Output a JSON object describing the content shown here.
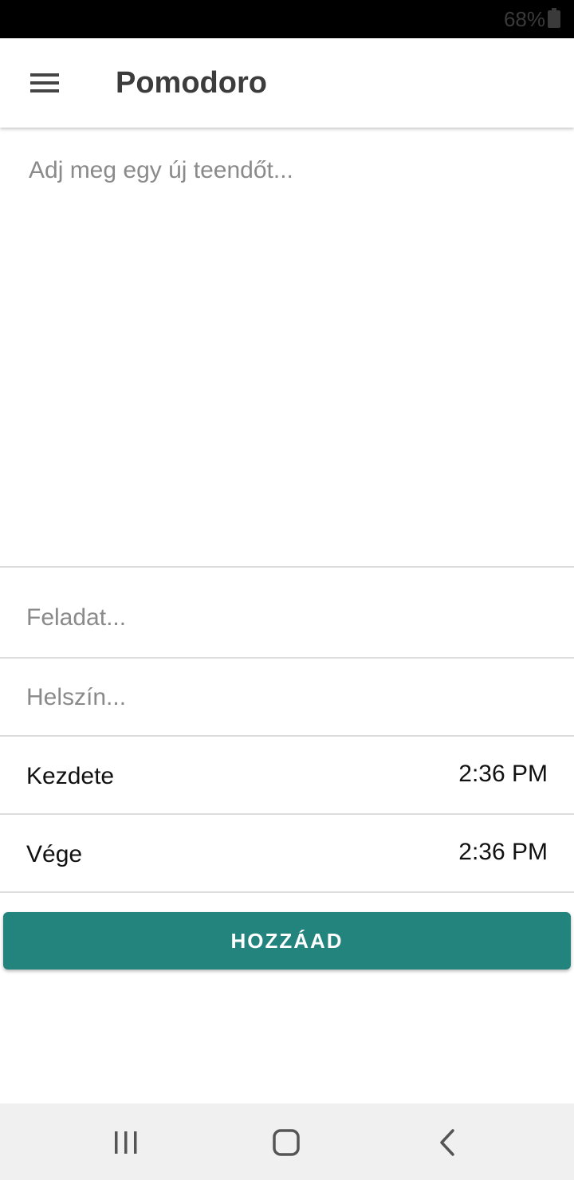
{
  "status_bar": {
    "battery": "68%"
  },
  "app_bar": {
    "title": "Pomodoro",
    "menu_icon": "hamburger-menu-icon"
  },
  "todo": {
    "placeholder": "Adj meg egy új teendőt..."
  },
  "form": {
    "task_placeholder": "Feladat...",
    "location_placeholder": "Helszín...",
    "start_label": "Kezdete",
    "start_time": "2:36 PM",
    "end_label": "Vége",
    "end_time": "2:36 PM",
    "add_label": "HOZZÁAD"
  },
  "nav": {
    "recents_icon": "recents-icon",
    "home_icon": "home-icon",
    "back_icon": "back-icon"
  },
  "colors": {
    "accent": "#23847e",
    "status_bar": "#000000",
    "nav_bar": "#f0f0f0"
  }
}
